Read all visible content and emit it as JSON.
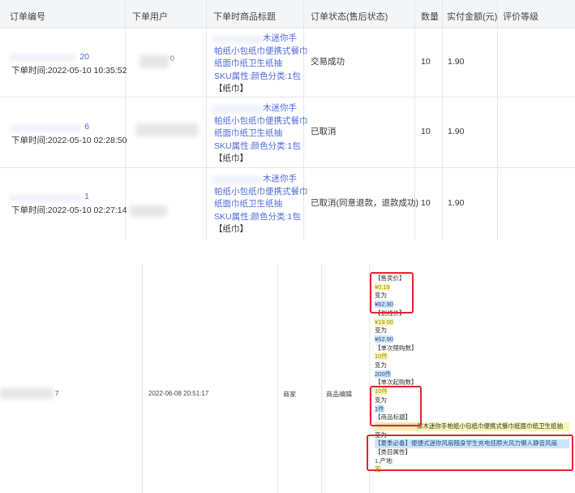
{
  "table": {
    "headers": [
      "订单编号",
      "下单用户",
      "下单时商品标题",
      "订单状态(售后状态)",
      "数量",
      "实付金额(元)",
      "评价等级"
    ],
    "rows": [
      {
        "order_suffix": "20",
        "order_time": "下单时间:2022-05-10 10:35:52",
        "user_suffix": "0",
        "title_lines": [
          "木迷你手",
          "帕纸小包纸巾便携式餐巾",
          "纸面巾纸卫生纸抽"
        ],
        "sku": "SKU属性:颜色分类:1包",
        "sku_extra": "【纸巾】",
        "status": "交易成功",
        "qty": "10",
        "amount": "1.90"
      },
      {
        "order_suffix": "6",
        "order_time": "下单时间:2022-05-10 02:28:50",
        "user_suffix": "",
        "title_lines": [
          "木迷你手",
          "帕纸小包纸巾便携式餐巾",
          "纸面巾纸卫生纸抽"
        ],
        "sku": "SKU属性:颜色分类:1包",
        "sku_extra": "【纸巾】",
        "status": "已取消",
        "qty": "10",
        "amount": "1.90"
      },
      {
        "order_suffix": "1",
        "order_time": "下单时间:2022-05-10 02:27:14",
        "user_suffix": "",
        "title_lines": [
          "木迷你手",
          "帕纸小包纸巾便携式餐巾",
          "纸面巾纸卫生纸抽"
        ],
        "sku": "SKU属性:颜色分类:1包",
        "sku_extra": "【纸巾】",
        "status": "已取消(同意退款，退款成功)",
        "qty": "10",
        "amount": "1.90"
      }
    ]
  },
  "log": {
    "id_suffix": "7",
    "time": "2022-06-08 20:51:17",
    "operator": "商家",
    "action": "商品编辑",
    "changes": {
      "sale_price_label": "【售卖价】",
      "sale_price_old": "¥0.19",
      "change_word": "变为",
      "sale_price_new": "¥62.90",
      "list_price_label": "【划线价】",
      "list_price_old": "¥19.00",
      "list_price_new": "¥62.90",
      "max_qty_label": "【单次限购数】",
      "max_qty_old": "10件",
      "max_qty_new": "200件",
      "min_qty_label": "【单次起购数】",
      "min_qty_old": "10件",
      "min_qty_new": "1件",
      "title_label": "【商品标题】",
      "title_old": "原木迷你手帕纸小包纸巾便携式餐巾纸面巾纸卫生纸抽",
      "title_new": "【夏季必备】便捷式迷你风扇随身学生充电挂脖大风力懒人静音风扇",
      "attr_label": "【类目属性】",
      "attr_item": "1.产地:",
      "attr_value": "无"
    }
  }
}
